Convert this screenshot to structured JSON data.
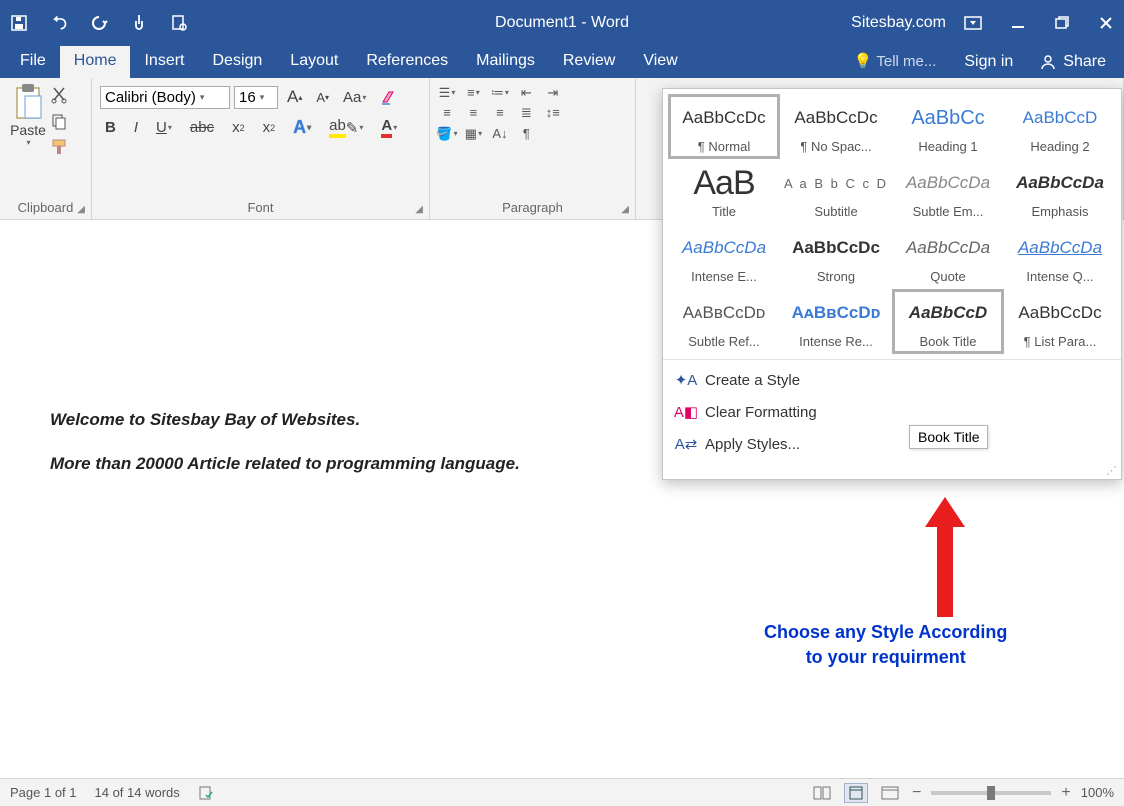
{
  "titlebar": {
    "title": "Document1 - Word",
    "site": "Sitesbay.com"
  },
  "tabs": {
    "file": "File",
    "home": "Home",
    "insert": "Insert",
    "design": "Design",
    "layout": "Layout",
    "references": "References",
    "mailings": "Mailings",
    "review": "Review",
    "view": "View",
    "tellme": "Tell me...",
    "signin": "Sign in",
    "share": "Share"
  },
  "ribbon": {
    "clipboard": {
      "label": "Clipboard",
      "paste": "Paste"
    },
    "font": {
      "label": "Font",
      "name": "Calibri (Body)",
      "size": "16"
    },
    "paragraph": {
      "label": "Paragraph"
    }
  },
  "document": {
    "line1": "Welcome to Sitesbay Bay of Websites.",
    "line2": "More than 20000 Article related to programming language."
  },
  "styles": {
    "tiles": [
      {
        "preview": "AaBbCcDc",
        "label": "¶ Normal",
        "class": ""
      },
      {
        "preview": "AaBbCcDc",
        "label": "¶ No Spac...",
        "class": ""
      },
      {
        "preview": "AaBbCc",
        "label": "Heading 1",
        "class": "head1"
      },
      {
        "preview": "AaBbCcD",
        "label": "Heading 2",
        "class": "head2"
      },
      {
        "preview": "AaB",
        "label": "Title",
        "class": "title"
      },
      {
        "preview": "A a B b C c D",
        "label": "Subtitle",
        "class": "subtitle"
      },
      {
        "preview": "AaBbCcDa",
        "label": "Subtle Em...",
        "class": "subtle-em"
      },
      {
        "preview": "AaBbCcDa",
        "label": "Emphasis",
        "class": "emphasis"
      },
      {
        "preview": "AaBbCcDa",
        "label": "Intense E...",
        "class": "intense-e"
      },
      {
        "preview": "AaBbCcDc",
        "label": "Strong",
        "class": "strong"
      },
      {
        "preview": "AaBbCcDa",
        "label": "Quote",
        "class": "quote"
      },
      {
        "preview": "AaBbCcDa",
        "label": "Intense Q...",
        "class": "intense-q"
      },
      {
        "preview": "AᴀBʙCᴄDᴅ",
        "label": "Subtle Ref...",
        "class": "subtle-ref"
      },
      {
        "preview": "AᴀBʙCᴄDᴅ",
        "label": "Intense Re...",
        "class": "intense-re"
      },
      {
        "preview": "AaBbCcD",
        "label": "Book Title",
        "class": "book-title"
      },
      {
        "preview": "AaBbCcDc",
        "label": "¶ List Para...",
        "class": ""
      }
    ],
    "menu": {
      "create": "Create a Style",
      "clear": "Clear Formatting",
      "apply": "Apply Styles..."
    }
  },
  "tooltip": "Book Title",
  "annotation": {
    "l1": "Choose any Style According",
    "l2": "to your requirment"
  },
  "statusbar": {
    "page": "Page 1 of 1",
    "words": "14 of 14 words",
    "zoom": "100%"
  }
}
